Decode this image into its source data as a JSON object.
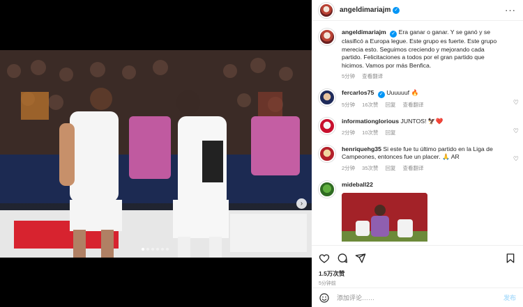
{
  "post": {
    "username": "angeldimariajm",
    "caption": "Era ganar o ganar. Y se ganó y se clasificó a Europa legue. Este grupo es fuerte. Este grupo merecia esto. Seguimos creciendo y mejorando cada partido. Felicitaciones a todos por el gran partido que hicimos. Vamos por más Benfica.",
    "caption_time": "5分钟",
    "caption_translate": "查看翻译",
    "likes": "1.5万次赞",
    "time": "5分钟前",
    "composer_placeholder": "添加评论……",
    "post_label": "发布"
  },
  "comments": [
    {
      "username": "fercarlos75",
      "text": "Uuuuuuf",
      "emoji": "🔥",
      "time": "5分钟",
      "likes": "16次赞",
      "reply": "回复",
      "translate": "查看翻译"
    },
    {
      "username": "informationglorious",
      "text": "JUNTOS!",
      "emoji": "🦅❤️",
      "time": "2分钟",
      "likes": "10次赞",
      "reply": "回复"
    },
    {
      "username": "henriquehg35",
      "text": "Si este fue tu último partido en la Liga de Campeones, entonces fue un placer.",
      "emoji": "🙏 AR",
      "time": "2分钟",
      "likes": "35次赞",
      "reply": "回复",
      "translate": "查看翻译"
    },
    {
      "username": "mideball22"
    }
  ],
  "icons": {
    "more": "more-horizontal-icon",
    "like": "heart-icon",
    "comment": "comment-icon",
    "share": "share-icon",
    "save": "bookmark-icon",
    "emoji": "emoji-icon",
    "verified": "verified-badge-icon",
    "next": "chevron-right-icon"
  }
}
